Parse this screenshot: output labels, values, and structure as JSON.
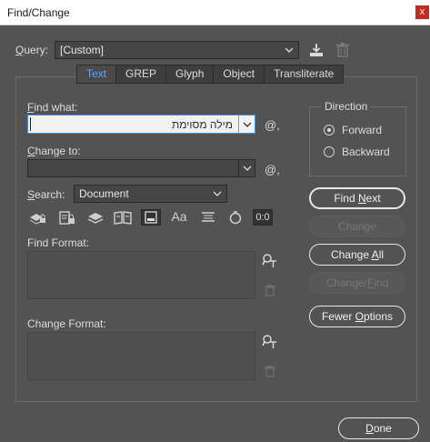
{
  "window": {
    "title": "Find/Change",
    "close_glyph": "x"
  },
  "query": {
    "label": "Query:",
    "underline": "Q",
    "rest": "uery:",
    "value": "[Custom]",
    "save_icon": "download-icon",
    "delete_icon": "trash-icon"
  },
  "tabs": [
    {
      "label": "Text",
      "active": true
    },
    {
      "label": "GREP",
      "active": false
    },
    {
      "label": "Glyph",
      "active": false
    },
    {
      "label": "Object",
      "active": false
    },
    {
      "label": "Transliterate",
      "active": false
    }
  ],
  "find_what": {
    "label_u": "F",
    "label_rest": "ind what:",
    "value": "מילה מסוימת",
    "special_icon": "@,"
  },
  "change_to": {
    "label_u": "C",
    "label_rest": "hange to:",
    "value": "",
    "special_icon": "@,"
  },
  "search": {
    "label_u": "S",
    "label_rest": "earch:",
    "value": "Document"
  },
  "options_icons": [
    "include-locked-layers-icon",
    "include-locked-stories-icon",
    "include-hidden-layers-icon",
    "include-master-pages-icon",
    "include-footnotes-icon",
    "case-sensitive-icon",
    "whole-word-icon",
    "kana-sensitive-icon",
    "width-sensitive-icon"
  ],
  "options_text": {
    "case": "Aa",
    "width": "0:0"
  },
  "find_format": {
    "label": "Find Format:"
  },
  "change_format": {
    "label": "Change Format:"
  },
  "direction": {
    "title": "Direction",
    "forward": "Forward",
    "backward": "Backward",
    "selected": "forward"
  },
  "buttons": {
    "find_next_u": "Find ",
    "find_next_k": "N",
    "find_next_r": "ext",
    "change": "Change",
    "change_all_a": "Change ",
    "change_all_u": "A",
    "change_all_b": "ll",
    "change_find_a": "Change/",
    "change_find_u": "F",
    "change_find_b": "ind",
    "fewer_a": "Fewer ",
    "fewer_u": "O",
    "fewer_b": "ptions",
    "done_u": "D",
    "done_b": "one"
  },
  "colors": {
    "background": "#535353",
    "active_tab": "#5aa7ff",
    "close": "#c42b1c"
  }
}
